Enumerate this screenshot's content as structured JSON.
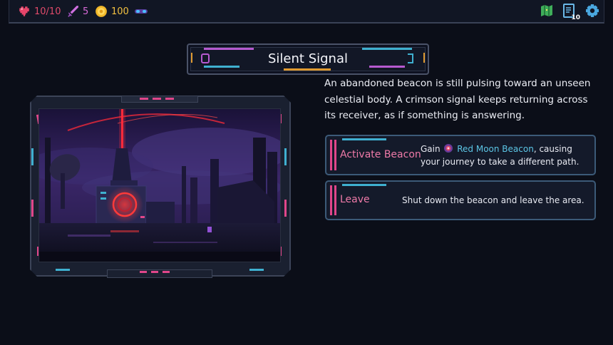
{
  "hud": {
    "hp": "10/10",
    "attack": "5",
    "gold": "100",
    "deck_count": "10",
    "icons": [
      "heart-icon",
      "sword-icon",
      "coin-icon",
      "goggles-icon",
      "map-icon",
      "deck-icon",
      "gear-icon"
    ]
  },
  "event": {
    "title": "Silent Signal",
    "description": "An abandoned beacon is still pulsing toward an unseen celestial body. A crimson signal keeps returning across its receiver, as if something is answering."
  },
  "choices": [
    {
      "label": "Activate Beacon",
      "desc_prefix": "Gain",
      "item_name": "Red Moon Beacon",
      "desc_suffix": ", causing your journey to take a different path.",
      "item_icon": "red-moon-beacon-icon"
    },
    {
      "label": "Leave",
      "desc": "Shut down the beacon and leave the area."
    }
  ],
  "colors": {
    "background": "#0b0e18",
    "accent_pink": "#e0468a",
    "accent_cyan": "#3fb0d0",
    "choice_label": "#ee7aa8",
    "item_highlight": "#5cc6e6"
  }
}
